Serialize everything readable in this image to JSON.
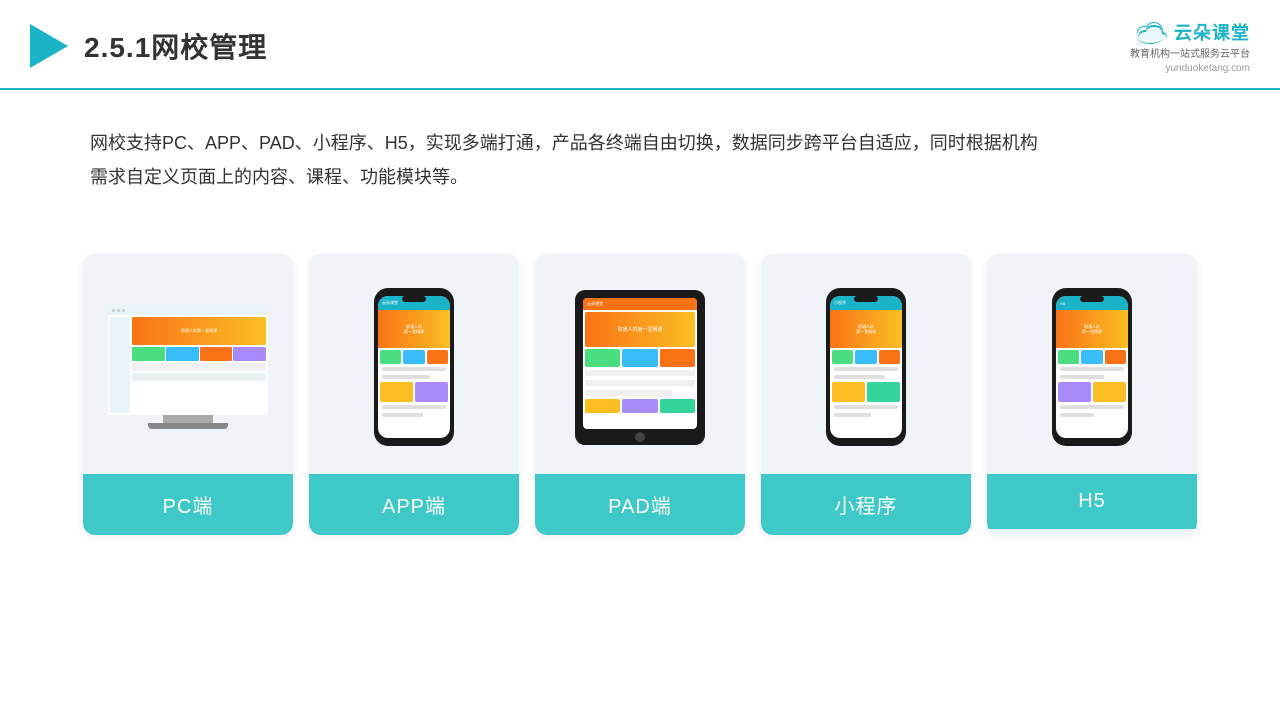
{
  "header": {
    "title_number": "2.5.1",
    "title_text": "网校管理",
    "brand_name": "云朵课堂",
    "brand_tagline": "教育机构一站\n式服务云平台",
    "brand_url": "yunduoketang.com"
  },
  "description": {
    "text": "网校支持PC、APP、PAD、小程序、H5，实现多端打通，产品各终端自由切换，数据同步跨平台自适应，同时根据机构\n需求自定义页面上的内容、课程、功能模块等。"
  },
  "cards": [
    {
      "id": "pc",
      "label": "PC端"
    },
    {
      "id": "app",
      "label": "APP端"
    },
    {
      "id": "pad",
      "label": "PAD端"
    },
    {
      "id": "miniprogram",
      "label": "小程序"
    },
    {
      "id": "h5",
      "label": "H5"
    }
  ]
}
